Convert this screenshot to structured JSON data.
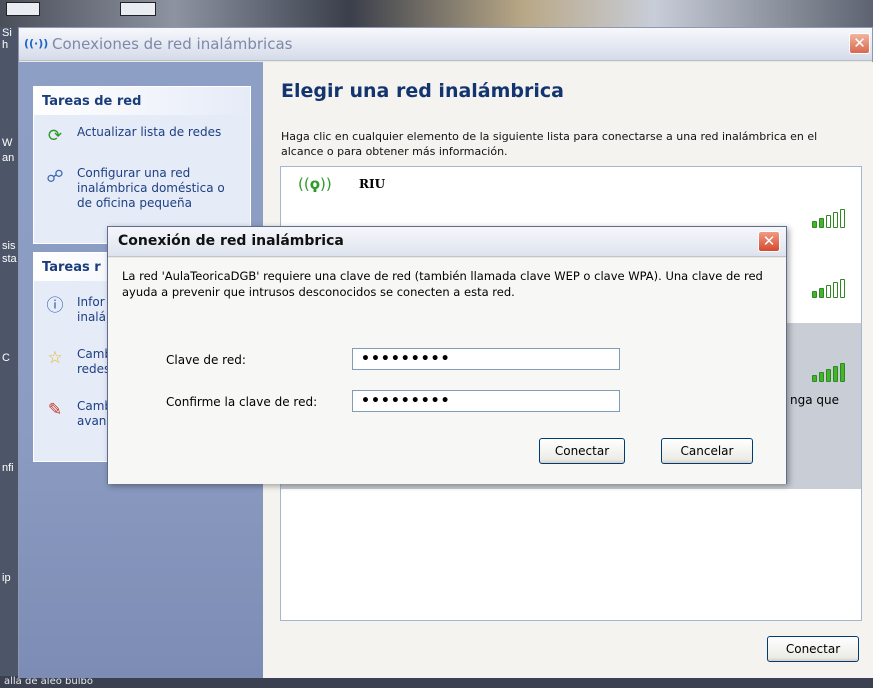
{
  "window": {
    "title": "Conexiones de red inalámbricas",
    "icon": "wireless-icon"
  },
  "taskpane": {
    "box1": {
      "title": "Tareas de red",
      "items": [
        {
          "label": "Actualizar lista de redes",
          "icon": "refresh-icon"
        },
        {
          "label": "Configurar una red inalámbrica doméstica o de oficina pequeña",
          "icon": "network-setup-icon"
        }
      ]
    },
    "box2": {
      "title": "Tareas r",
      "items": [
        {
          "label": "Infor inalá",
          "icon": "info-icon"
        },
        {
          "label": "Camb redes",
          "icon": "star-icon"
        },
        {
          "label": "Camb avan",
          "icon": "advanced-settings-icon"
        }
      ]
    }
  },
  "content": {
    "heading": "Elegir una red inalámbrica",
    "description": "Haga clic en cualquier elemento de la siguiente lista para conectarse a una red inalámbrica en el alcance o para obtener más información.",
    "networks": [
      {
        "name": "RIU",
        "signal": 0.4
      },
      {
        "name": "",
        "signal": 0.4
      },
      {
        "name": "",
        "signal": 1.0,
        "extra": "nga que",
        "selected": true
      }
    ],
    "connect_button": "Conectar"
  },
  "modal": {
    "title": "Conexión de red inalámbrica",
    "message": "La red 'AulaTeoricaDGB' requiere una clave de red (también llamada clave WEP o clave WPA). Una clave de red ayuda a prevenir que intrusos desconocidos se conecten a esta red.",
    "key_label": "Clave de red:",
    "confirm_label": "Confirme la clave de red:",
    "key_value": "•••••••••",
    "confirm_value": "•••••••••",
    "connect_button": "Conectar",
    "cancel_button": "Cancelar"
  },
  "desktop": {
    "left_glyphs": [
      "Si",
      "h",
      "W",
      "an",
      "sis",
      "sta",
      "C",
      "nfi",
      "ip"
    ],
    "bottom_text": "alla de aleo       bulbo"
  }
}
